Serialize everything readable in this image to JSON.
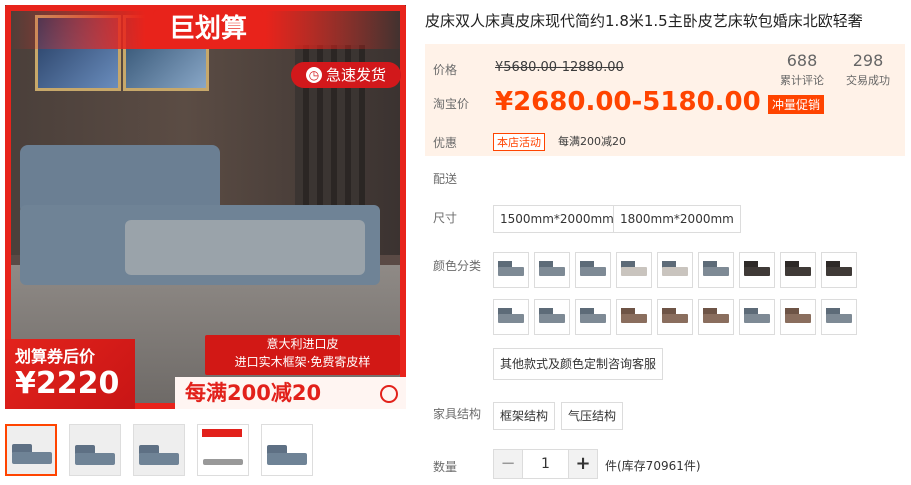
{
  "product": {
    "title": "皮床双人床真皮床现代简约1.8米1.5主卧皮艺床软包婚床北欧轻奢"
  },
  "main_image": {
    "brand_text": "巨划算",
    "ship_text": "急速发货",
    "coupon_label": "划算券后价",
    "coupon_price": "¥2220",
    "feature_line1": "意大利进口皮",
    "feature_line2": "进口实木框架·免费寄皮样",
    "deal_text": "每满200减20"
  },
  "thumbnails": [
    {
      "name": "thumb-1",
      "selected": true
    },
    {
      "name": "thumb-2",
      "selected": false
    },
    {
      "name": "thumb-3",
      "selected": false
    },
    {
      "name": "thumb-4",
      "selected": false
    },
    {
      "name": "thumb-5",
      "selected": false
    }
  ],
  "pricing": {
    "price_label": "价格",
    "original_price": "¥5680.00-12880.00",
    "taobao_label": "淘宝价",
    "current_price": "¥2680.00-5180.00",
    "promo_tag": "冲量促销",
    "reviews_count": "688",
    "reviews_label": "累计评论",
    "sales_count": "298",
    "sales_label": "交易成功",
    "discount_label": "优惠",
    "store_event": "本店活动",
    "discount_text": "每满200减20"
  },
  "delivery_label": "配送",
  "size": {
    "label": "尺寸",
    "options": [
      "1500mm*2000mm",
      "1800mm*2000mm"
    ]
  },
  "color": {
    "label": "颜色分类",
    "custom_option": "其他款式及颜色定制咨询客服"
  },
  "structure": {
    "label": "家具结构",
    "options": [
      "框架结构",
      "气压结构"
    ]
  },
  "quantity": {
    "label": "数量",
    "value": "1",
    "minus": "−",
    "plus": "+",
    "stock_text": "件(库存70961件)"
  },
  "colors": {
    "accent": "#ff4400",
    "brand_red": "#e8231b",
    "price_bg": "#fff2e8"
  }
}
